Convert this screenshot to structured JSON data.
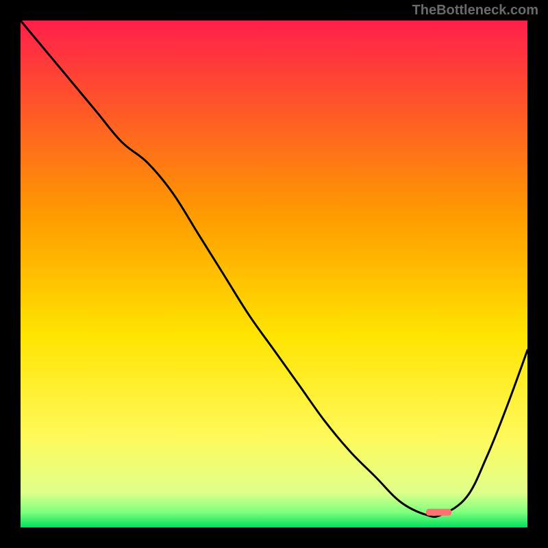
{
  "attribution": "TheBottleneck.com",
  "chart_data": {
    "type": "line",
    "title": "",
    "xlabel": "",
    "ylabel": "",
    "xlim": [
      0,
      100
    ],
    "ylim": [
      0,
      100
    ],
    "x": [
      0,
      5,
      10,
      15,
      20,
      25,
      30,
      35,
      40,
      45,
      50,
      55,
      60,
      65,
      70,
      75,
      80,
      83,
      88,
      92,
      96,
      100
    ],
    "values": [
      100,
      94,
      88,
      82,
      76,
      72,
      66,
      58,
      50,
      42,
      35,
      28,
      21,
      15,
      10,
      5,
      2.5,
      2.5,
      6,
      14,
      24,
      35
    ],
    "marker": {
      "x_start": 80,
      "x_end": 85,
      "y": 3,
      "color": "#ff7272"
    },
    "background_gradient": {
      "top": "#ff1f4a",
      "mid1": "#ff9a00",
      "mid2": "#ffe400",
      "mid3": "#fff95a",
      "low": "#e0ff8a",
      "bottom_band": "#00e05a"
    }
  }
}
